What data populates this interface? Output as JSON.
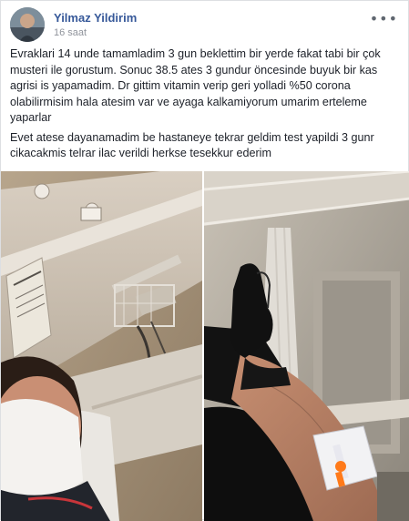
{
  "post": {
    "author": "Yilmaz Yildirim",
    "timestamp": "16 saat",
    "more_icon": "more-horizontal-icon",
    "paragraphs": [
      "Evraklari 14 unde tamamladim 3 gun beklettim bir yerde fakat tabi bir çok musteri ile gorustum. Sonuc 38.5 ates 3 gundur öncesinde buyuk bir kas agrisi is yapamadim. Dr gittim vitamin verip geri yolladi %50 corona olabilirmisim hala atesim var ve ayaga kalkamiyorum umarim erteleme yaparlar",
      "Evet atese dayanamadim be hastaneye tekrar geldim test yapildi 3 gunr cikacakmis telrar ilac verildi herkse tesekkur ederim"
    ]
  },
  "colors": {
    "author_link": "#365899",
    "meta_text": "#90949c",
    "body_text": "#1d2129"
  }
}
